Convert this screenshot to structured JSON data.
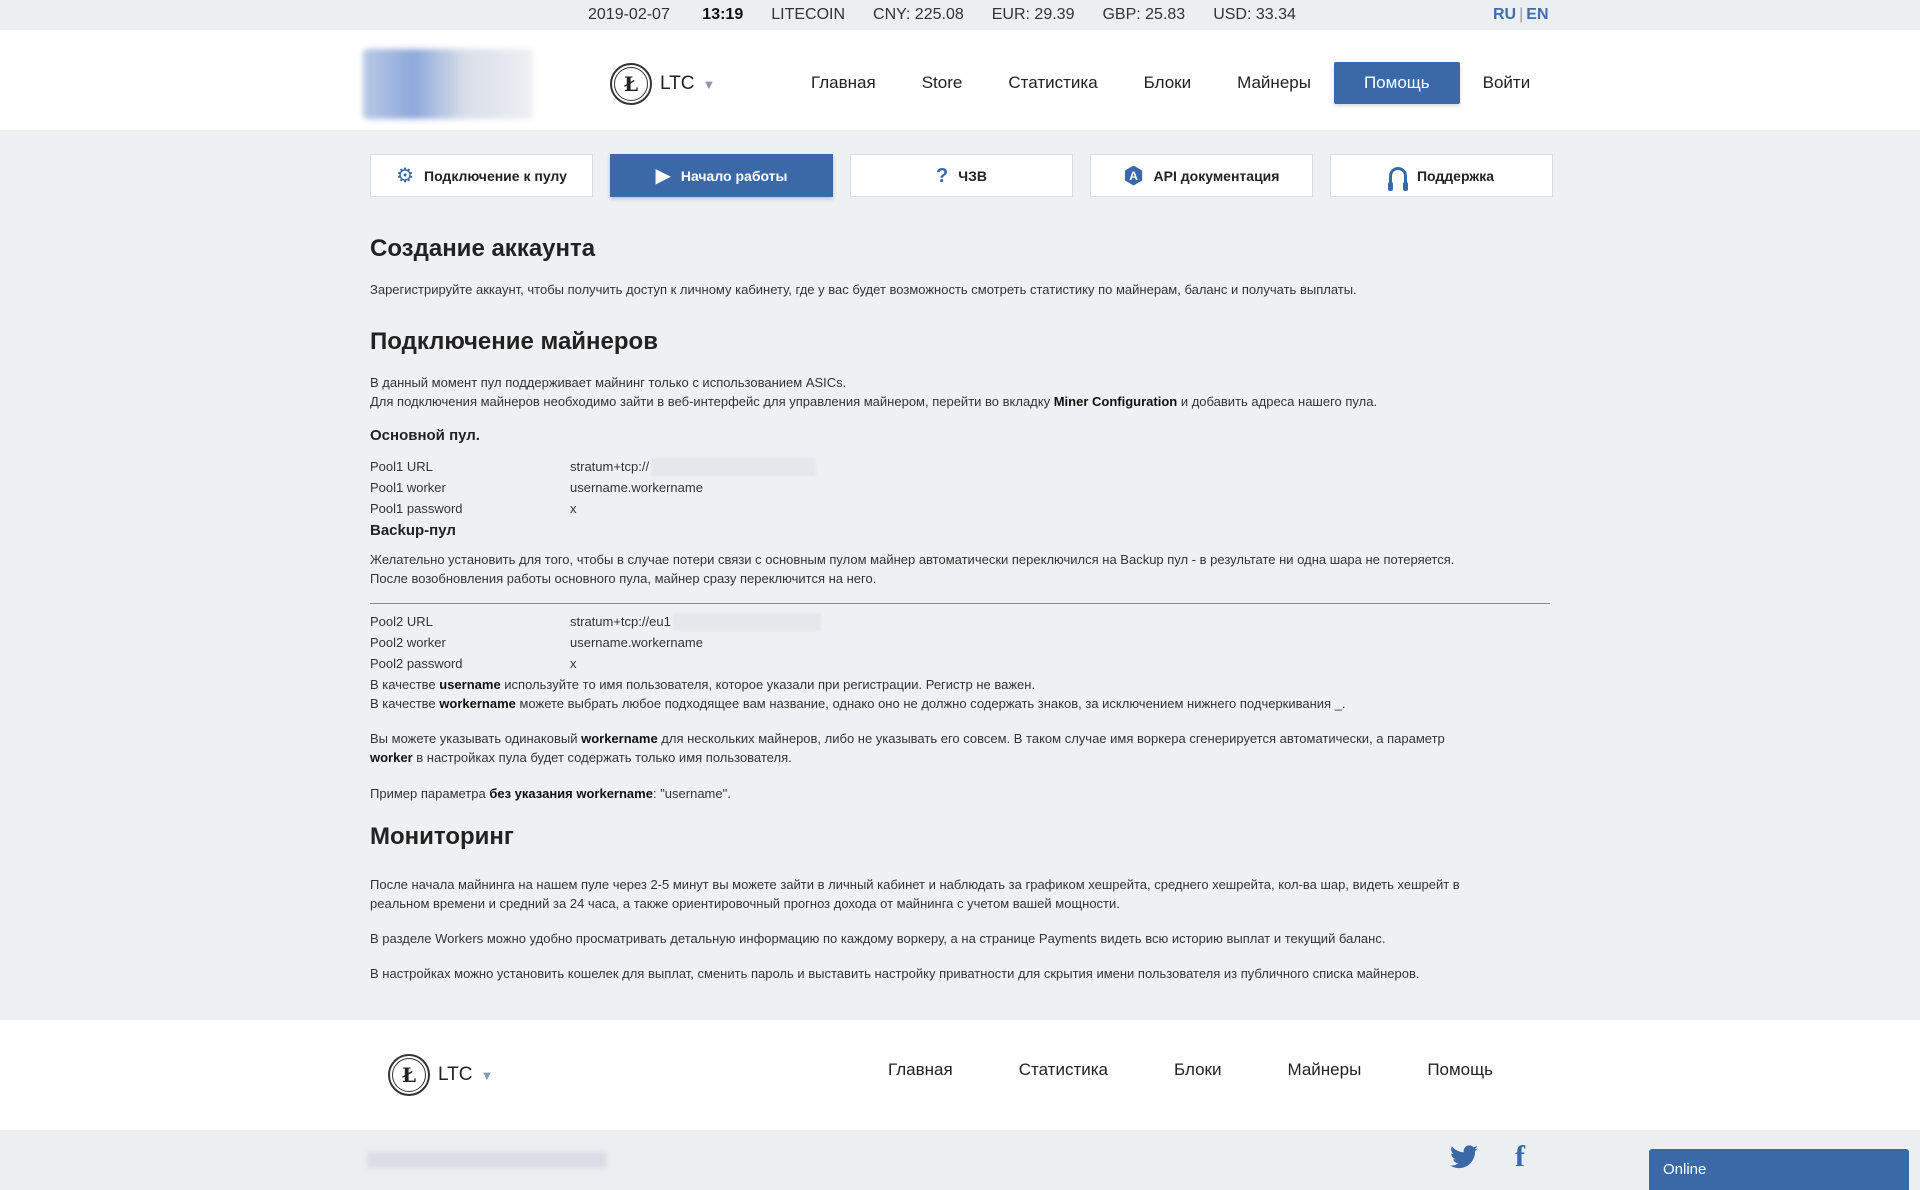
{
  "ticker": {
    "date": "2019-02-07",
    "time": "13:19",
    "coin": "LITECOIN",
    "cny": "CNY: 225.08",
    "eur": "EUR: 29.39",
    "gbp": "GBP: 25.83",
    "usd": "USD: 33.34",
    "lang_ru": "RU",
    "lang_sep": "|",
    "lang_en": "EN"
  },
  "header": {
    "coin_label": "LTC",
    "coin_symbol": "Ł",
    "caret": "▼",
    "nav": [
      "Главная",
      "Store",
      "Статистика",
      "Блоки",
      "Майнеры",
      "Помощь",
      "Войти"
    ],
    "active_nav": "Помощь"
  },
  "tabs": [
    {
      "label": "Подключение к пулу",
      "icon": "gear-icon",
      "glyph": "⚙"
    },
    {
      "label": "Начало работы",
      "icon": "play-icon",
      "glyph": "▶"
    },
    {
      "label": "ЧЗВ",
      "icon": "question-icon",
      "glyph": "?"
    },
    {
      "label": "API документация",
      "icon": "api-icon",
      "glyph": "A"
    },
    {
      "label": "Поддержка",
      "icon": "headset-icon",
      "glyph": ""
    }
  ],
  "content": {
    "h_account": "Создание аккаунта",
    "p_account": "Зарегистрируйте аккаунт, чтобы получить доступ к личному кабинету, где у вас будет возможность смотреть статистику по майнерам, баланс и получать выплаты.",
    "h_miners": "Подключение майнеров",
    "p_miners_1": "В данный момент пул поддерживает майнинг только с использованием ASICs.",
    "p_miners_2a": "Для подключения майнеров необходимо зайти в веб-интерфейс для управления майнером, перейти во вкладку ",
    "p_miners_2b": "Miner Configuration",
    "p_miners_2c": " и добавить адреса нашего пула.",
    "h_main_pool": "Основной пул.",
    "pool1": [
      {
        "k": "Pool1 URL",
        "v": "stratum+tcp://"
      },
      {
        "k": "Pool1 worker",
        "v": "username.workername"
      },
      {
        "k": "Pool1 password",
        "v": "x"
      }
    ],
    "h_backup": "Backup-пул",
    "p_backup_1": "Желательно установить для того, чтобы в случае потери связи с основным пулом майнер автоматически переключился на Backup пул - в результате ни одна шара не потеряется.",
    "p_backup_2": "После возобновления работы основного пула, майнер сразу переключится на него.",
    "pool2": [
      {
        "k": "Pool2 URL",
        "v": "stratum+tcp://eu1"
      },
      {
        "k": "Pool2 worker",
        "v": "username.workername"
      },
      {
        "k": "Pool2 password",
        "v": "x"
      }
    ],
    "p_user_a": "В качестве ",
    "p_user_b": "username",
    "p_user_c": " используйте то имя пользователя, которое указали при регистрации. Регистр не важен.",
    "p_worker_a": "В качестве ",
    "p_worker_b": "workername",
    "p_worker_c": " можете выбрать любое подходящее вам название, однако оно не должно содержать знаков, за исключением нижнего подчеркивания _.",
    "p_same_a": "Вы можете указывать одинаковый ",
    "p_same_b": "workername",
    "p_same_c": " для нескольких майнеров, либо не указывать его совсем. В таком случае имя воркера сгенерируется автоматически, а параметр",
    "p_same_d": "worker",
    "p_same_e": " в настройках пула будет содержать только имя пользователя.",
    "p_example_a": "Пример параметра ",
    "p_example_b": "без указания workername",
    "p_example_c": ": \"username\".",
    "h_monitor": "Мониторинг",
    "p_mon_1": "После начала майнинга на нашем пуле через 2-5 минут вы можете зайти в личный кабинет и наблюдать за графиком хешрейта, среднего хешрейта, кол-ва шар, видеть хешрейт в",
    "p_mon_2": "реальном времени и средний за 24 часа, а также ориентировочный прогноз дохода от майнинга с учетом вашей мощности.",
    "p_mon_3": "В разделе Workers можно удобно просматривать детальную информацию по каждому воркеру, а на странице Payments видеть всю историю выплат и текущий баланс.",
    "p_mon_4": "В настройках можно установить кошелек для выплат, сменить пароль и выставить настройку приватности для скрытия имени пользователя из публичного списка майнеров."
  },
  "footer": {
    "coin_label": "LTC",
    "coin_symbol": "Ł",
    "caret": "▼",
    "nav": [
      "Главная",
      "Статистика",
      "Блоки",
      "Майнеры",
      "Помощь"
    ],
    "twitter": "twitter-icon",
    "facebook": "facebook-icon",
    "facebook_glyph": "f"
  },
  "chat": {
    "label": "Online"
  },
  "colors": {
    "accent": "#3b69a8",
    "background": "#eef1f4"
  }
}
